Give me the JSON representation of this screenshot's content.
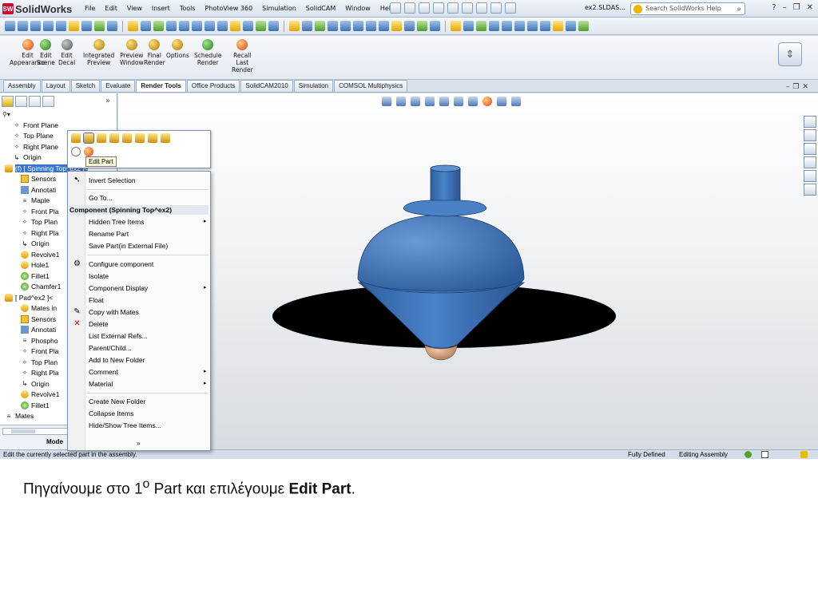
{
  "app": {
    "title": "SolidWorks",
    "document": "ex2.SLDAS...",
    "search_placeholder": "Search SolidWorks Help"
  },
  "menu": [
    "File",
    "Edit",
    "View",
    "Insert",
    "Tools",
    "PhotoView 360",
    "Simulation",
    "SolidCAM",
    "Window",
    "Help"
  ],
  "ribbon": [
    {
      "line1": "Edit",
      "line2": "Appearance",
      "line3": ""
    },
    {
      "line1": "Edit",
      "line2": "Scene",
      "line3": ""
    },
    {
      "line1": "Edit",
      "line2": "Decal",
      "line3": ""
    },
    {
      "line1": "Integrated",
      "line2": "Preview",
      "line3": ""
    },
    {
      "line1": "Preview",
      "line2": "Window",
      "line3": ""
    },
    {
      "line1": "Final",
      "line2": "Render",
      "line3": ""
    },
    {
      "line1": "Options",
      "line2": "",
      "line3": ""
    },
    {
      "line1": "Schedule",
      "line2": "Render",
      "line3": ""
    },
    {
      "line1": "Recall",
      "line2": "Last",
      "line3": "Render"
    }
  ],
  "tabs": [
    "Assembly",
    "Layout",
    "Sketch",
    "Evaluate",
    "Render Tools",
    "Office Products",
    "SolidCAM2010",
    "Simulation",
    "COMSOL Multiphysics"
  ],
  "active_tab": "Render Tools",
  "tree": [
    {
      "label": "Front Plane",
      "icon": "plane",
      "indent": 1
    },
    {
      "label": "Top Plane",
      "icon": "plane",
      "indent": 1
    },
    {
      "label": "Right Plane",
      "icon": "plane",
      "indent": 1
    },
    {
      "label": "Origin",
      "icon": "origin",
      "indent": 1
    },
    {
      "label": "(f) [ Spinning Top^ex2 ]<",
      "icon": "part",
      "indent": 0,
      "selected": true
    },
    {
      "label": "Sensors",
      "icon": "fold",
      "indent": 2
    },
    {
      "label": "Annotati",
      "icon": "blue",
      "indent": 2
    },
    {
      "label": "Maple",
      "icon": "mat",
      "indent": 2
    },
    {
      "label": "Front Pla",
      "icon": "plane",
      "indent": 2
    },
    {
      "label": "Top Plan",
      "icon": "plane",
      "indent": 2
    },
    {
      "label": "Right Pla",
      "icon": "plane",
      "indent": 2
    },
    {
      "label": "Origin",
      "icon": "origin",
      "indent": 2
    },
    {
      "label": "Revolve1",
      "icon": "feat",
      "indent": 2
    },
    {
      "label": "Hole1",
      "icon": "feat",
      "indent": 2
    },
    {
      "label": "Fillet1",
      "icon": "green",
      "indent": 2
    },
    {
      "label": "Chamfer1",
      "icon": "green",
      "indent": 2
    },
    {
      "label": "[ Pad^ex2 ]<",
      "icon": "part",
      "indent": 0
    },
    {
      "label": "Mates in",
      "icon": "feat",
      "indent": 2
    },
    {
      "label": "Sensors",
      "icon": "fold",
      "indent": 2
    },
    {
      "label": "Annotati",
      "icon": "blue",
      "indent": 2
    },
    {
      "label": "Phospho",
      "icon": "mat",
      "indent": 2
    },
    {
      "label": "Front Pla",
      "icon": "plane",
      "indent": 2
    },
    {
      "label": "Top Plan",
      "icon": "plane",
      "indent": 2
    },
    {
      "label": "Right Pla",
      "icon": "plane",
      "indent": 2
    },
    {
      "label": "Origin",
      "icon": "origin",
      "indent": 2
    },
    {
      "label": "Revolve1",
      "icon": "feat",
      "indent": 2
    },
    {
      "label": "Fillet1",
      "icon": "green",
      "indent": 2
    },
    {
      "label": "Mates",
      "icon": "mat",
      "indent": 0
    }
  ],
  "left_bottom_tab": "Mode",
  "tooltip": "Edit Part",
  "context_menu": {
    "invert_selection": "Invert Selection",
    "go_to": "Go To...",
    "header": "Component (Spinning Top^ex2)",
    "items": [
      {
        "label": "Hidden Tree Items",
        "submenu": true
      },
      {
        "label": "Rename Part",
        "submenu": false
      },
      {
        "label": "Save Part(in External File)",
        "submenu": false
      },
      {
        "label": "Configure component",
        "submenu": false
      },
      {
        "label": "Isolate",
        "submenu": false
      },
      {
        "label": "Component Display",
        "submenu": true
      },
      {
        "label": "Float",
        "submenu": false
      },
      {
        "label": "Copy with Mates",
        "submenu": false
      },
      {
        "label": "Delete",
        "submenu": false
      },
      {
        "label": "List External Refs...",
        "submenu": false
      },
      {
        "label": "Parent/Child...",
        "submenu": false
      },
      {
        "label": "Add to New Folder",
        "submenu": false
      },
      {
        "label": "Comment",
        "submenu": true
      },
      {
        "label": "Material",
        "submenu": true
      },
      {
        "label": "Create New Folder",
        "submenu": false
      },
      {
        "label": "Collapse Items",
        "submenu": false
      },
      {
        "label": "Hide/Show Tree Items...",
        "submenu": false
      }
    ],
    "more": "»"
  },
  "status": {
    "left": "Edit the currently selected part in the assembly.",
    "state": "Fully Defined",
    "mode": "Editing Assembly"
  },
  "caption": {
    "text": "Πηγαίνουμε στο 1",
    "sup": "ο",
    "middle": " Part και επιλέγουμε ",
    "bold": "Edit Part",
    "end": "."
  },
  "colors": {
    "part_blue": "#3f75bd",
    "tip": "#d8a98a"
  }
}
